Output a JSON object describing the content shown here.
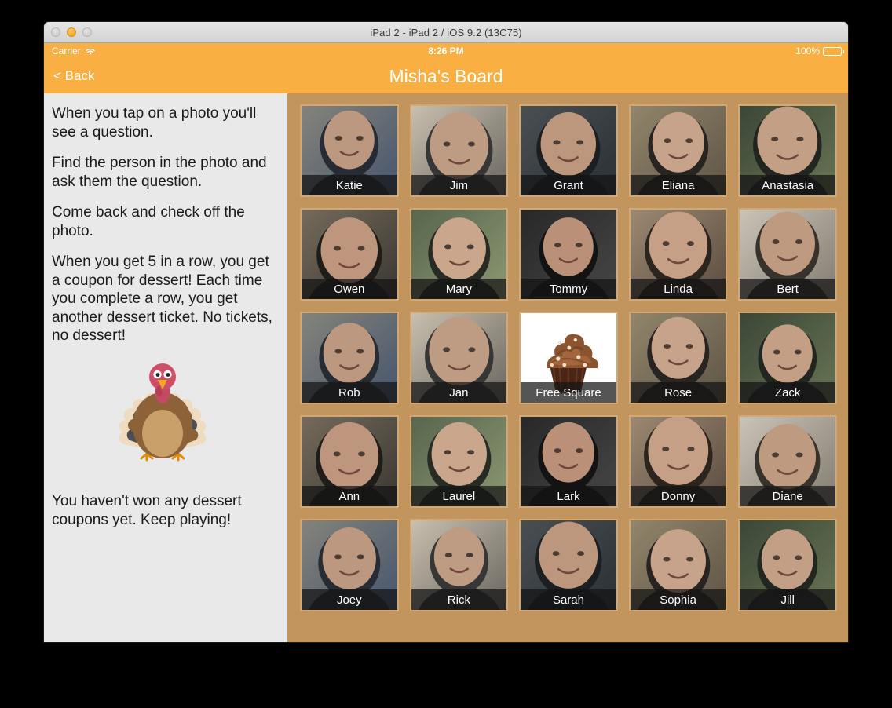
{
  "window": {
    "title": "iPad 2 - iPad 2 / iOS 9.2 (13C75)",
    "traffic_lights": [
      {
        "name": "close",
        "color": "#cfcfcf",
        "active": false
      },
      {
        "name": "minimize",
        "color": "#f5a623",
        "active": true
      },
      {
        "name": "fullscreen",
        "color": "#cfcfcf",
        "active": false
      }
    ]
  },
  "status_bar": {
    "carrier": "Carrier",
    "wifi_icon": "wifi-icon",
    "time": "8:26 PM",
    "battery_percent": "100%",
    "battery_icon": "battery-full-icon",
    "background_color": "#f9af42"
  },
  "nav_bar": {
    "back_label": "< Back",
    "title": "Misha's Board",
    "background_color": "#f9af42",
    "text_color": "#ffffff"
  },
  "sidebar": {
    "background_color": "#e9e9e9",
    "paragraphs": [
      "When you tap on a photo you'll see a question.",
      "Find the person in the photo and ask them the question.",
      "Come back and check off the photo.",
      "When you get 5 in a row, you get a coupon for dessert! Each time you complete a row, you get another dessert ticket. No tickets, no dessert!"
    ],
    "illustration": "turkey-illustration",
    "status_message": "You haven't won any dessert coupons yet. Keep playing!"
  },
  "board": {
    "background_color": "#c2955f",
    "tile_border_color": "#d2a771",
    "columns": 5,
    "rows": 5,
    "tiles": [
      {
        "name": "Katie",
        "kind": "photo"
      },
      {
        "name": "Jim",
        "kind": "photo"
      },
      {
        "name": "Grant",
        "kind": "photo"
      },
      {
        "name": "Eliana",
        "kind": "photo"
      },
      {
        "name": "Anastasia",
        "kind": "photo"
      },
      {
        "name": "Owen",
        "kind": "photo"
      },
      {
        "name": "Mary",
        "kind": "photo"
      },
      {
        "name": "Tommy",
        "kind": "photo"
      },
      {
        "name": "Linda",
        "kind": "photo"
      },
      {
        "name": "Bert",
        "kind": "photo"
      },
      {
        "name": "Rob",
        "kind": "photo"
      },
      {
        "name": "Jan",
        "kind": "photo"
      },
      {
        "name": "Free Square",
        "kind": "free"
      },
      {
        "name": "Rose",
        "kind": "photo"
      },
      {
        "name": "Zack",
        "kind": "photo"
      },
      {
        "name": "Ann",
        "kind": "photo"
      },
      {
        "name": "Laurel",
        "kind": "photo"
      },
      {
        "name": "Lark",
        "kind": "photo"
      },
      {
        "name": "Donny",
        "kind": "photo"
      },
      {
        "name": "Diane",
        "kind": "photo"
      },
      {
        "name": "Joey",
        "kind": "photo"
      },
      {
        "name": "Rick",
        "kind": "photo"
      },
      {
        "name": "Sarah",
        "kind": "photo"
      },
      {
        "name": "Sophia",
        "kind": "photo"
      },
      {
        "name": "Jill",
        "kind": "photo"
      }
    ]
  }
}
